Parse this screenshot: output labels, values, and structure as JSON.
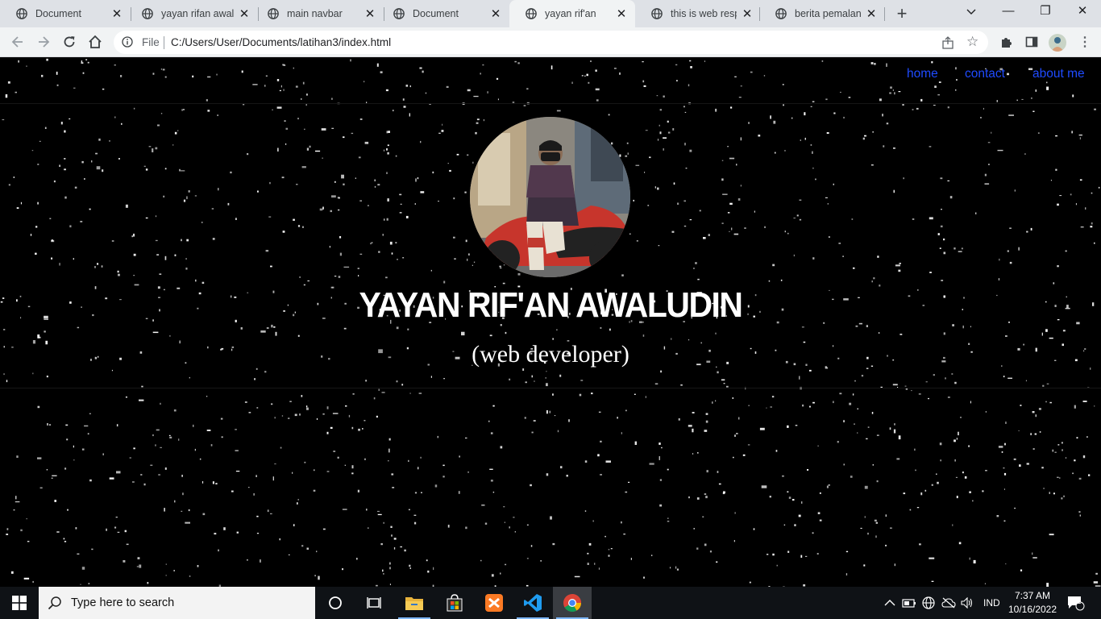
{
  "browser": {
    "tabs": [
      {
        "title": "Document",
        "active": false
      },
      {
        "title": "yayan rifan awaludin",
        "active": false
      },
      {
        "title": "main navbar",
        "active": false
      },
      {
        "title": "Document",
        "active": false
      },
      {
        "title": "yayan rif'an",
        "active": true
      },
      {
        "title": "this is web responsive",
        "active": false
      },
      {
        "title": "berita pemalang",
        "active": false
      }
    ],
    "new_tab": "+",
    "omnibox": {
      "scheme_label": "File",
      "url": "C:/Users/User/Documents/latihan3/index.html"
    },
    "window_controls": {
      "minimize": "—",
      "restore": "❐",
      "close": "✕"
    }
  },
  "page": {
    "nav": [
      {
        "label": "home"
      },
      {
        "label": "contact"
      },
      {
        "label": "about me"
      }
    ],
    "hero": {
      "name": "YAYAN RIF'AN AWALUDIN",
      "role": "(web developer)"
    }
  },
  "taskbar": {
    "search_placeholder": "Type here to search",
    "language": "IND",
    "time": "7:37 AM",
    "date": "10/16/2022",
    "notification_count": "1"
  },
  "colors": {
    "nav_link": "#1f4bff",
    "page_background": "#000000",
    "hero_text": "#ffffff"
  }
}
